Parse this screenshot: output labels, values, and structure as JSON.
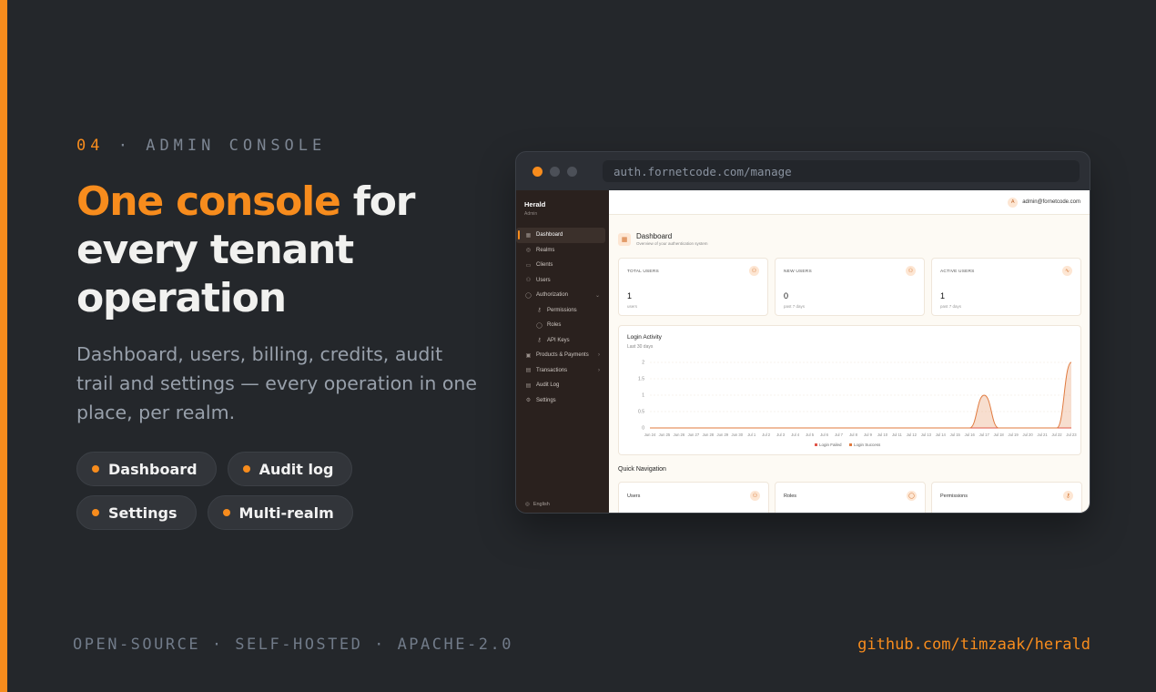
{
  "slide": {
    "number": "04",
    "eyebrow": "ADMIN CONSOLE",
    "headline_highlight": "One console",
    "headline_rest": " for every tenant operation",
    "lead": "Dashboard, users, billing, credits, audit trail and settings — every operation in one place, per realm.",
    "chips": [
      "Dashboard",
      "Audit log",
      "Settings",
      "Multi-realm"
    ],
    "footer_left": "OPEN-SOURCE · SELF-HOSTED · APACHE-2.0",
    "footer_right": "github.com/timzaak/herald",
    "accent_color": "#f78c1d"
  },
  "browser": {
    "url": "auth.fornetcode.com/manage"
  },
  "app": {
    "brand": "Herald",
    "brand_sub": "Admin",
    "user_initial": "A",
    "user_email": "admin@fornetcode.com",
    "nav": [
      {
        "label": "Dashboard",
        "icon": "grid-icon",
        "glyph": "▦",
        "active": true
      },
      {
        "label": "Realms",
        "icon": "globe-icon",
        "glyph": "◎"
      },
      {
        "label": "Clients",
        "icon": "card-icon",
        "glyph": "▭"
      },
      {
        "label": "Users",
        "icon": "users-icon",
        "glyph": "⚇"
      },
      {
        "label": "Authorization",
        "icon": "shield-icon",
        "glyph": "◯",
        "chevron": "⌄"
      },
      {
        "label": "Permissions",
        "icon": "key-icon",
        "glyph": "⚷",
        "sub": true
      },
      {
        "label": "Roles",
        "icon": "shield-icon",
        "glyph": "◯",
        "sub": true
      },
      {
        "label": "API Keys",
        "icon": "key-icon",
        "glyph": "⚷",
        "sub": true
      },
      {
        "label": "Products & Payments",
        "icon": "box-icon",
        "glyph": "▣",
        "chevron": "›"
      },
      {
        "label": "Transactions",
        "icon": "doc-icon",
        "glyph": "▤",
        "chevron": "›"
      },
      {
        "label": "Audit Log",
        "icon": "list-icon",
        "glyph": "▤"
      },
      {
        "label": "Settings",
        "icon": "gear-icon",
        "glyph": "⚙"
      }
    ],
    "language": "English",
    "page_title": "Dashboard",
    "page_subtitle": "Overview of your authentication system",
    "stats": [
      {
        "label": "TOTAL USERS",
        "value": "1",
        "sub": "users",
        "icon": "users-icon",
        "glyph": "⚇"
      },
      {
        "label": "NEW USERS",
        "value": "0",
        "sub": "past 7 days",
        "icon": "user-plus-icon",
        "glyph": "⚇"
      },
      {
        "label": "ACTIVE USERS",
        "value": "1",
        "sub": "past 7 days",
        "icon": "activity-icon",
        "glyph": "∿"
      }
    ],
    "quick_nav_title": "Quick Navigation",
    "quick_nav": [
      {
        "label": "Users",
        "icon": "users-icon",
        "glyph": "⚇"
      },
      {
        "label": "Roles",
        "icon": "shield-icon",
        "glyph": "◯"
      },
      {
        "label": "Permissions",
        "icon": "key-icon",
        "glyph": "⚷"
      }
    ]
  },
  "chart_data": {
    "type": "area",
    "title": "Login Activity",
    "subtitle": "Last 30 days",
    "categories": [
      "Jun 24",
      "Jun 25",
      "Jun 26",
      "Jun 27",
      "Jun 28",
      "Jun 29",
      "Jun 30",
      "Jul 1",
      "Jul 2",
      "Jul 3",
      "Jul 4",
      "Jul 5",
      "Jul 6",
      "Jul 7",
      "Jul 8",
      "Jul 9",
      "Jul 10",
      "Jul 11",
      "Jul 12",
      "Jul 13",
      "Jul 14",
      "Jul 15",
      "Jul 16",
      "Jul 17",
      "Jul 18",
      "Jul 19",
      "Jul 20",
      "Jul 21",
      "Jul 22",
      "Jul 23"
    ],
    "yticks": [
      "0",
      "0.5",
      "1",
      "1.5",
      "2"
    ],
    "ylim": [
      0,
      2
    ],
    "series": [
      {
        "name": "Login Failed",
        "color": "#e0564a",
        "values": [
          0,
          0,
          0,
          0,
          0,
          0,
          0,
          0,
          0,
          0,
          0,
          0,
          0,
          0,
          0,
          0,
          0,
          0,
          0,
          0,
          0,
          0,
          0,
          0,
          0,
          0,
          0,
          0,
          0,
          0
        ]
      },
      {
        "name": "Login Success",
        "color": "#e07a3e",
        "values": [
          0,
          0,
          0,
          0,
          0,
          0,
          0,
          0,
          0,
          0,
          0,
          0,
          0,
          0,
          0,
          0,
          0,
          0,
          0,
          0,
          0,
          0,
          0,
          1,
          0,
          0,
          0,
          0,
          0,
          2
        ]
      }
    ],
    "grid": true,
    "legend": "bottom-center"
  }
}
